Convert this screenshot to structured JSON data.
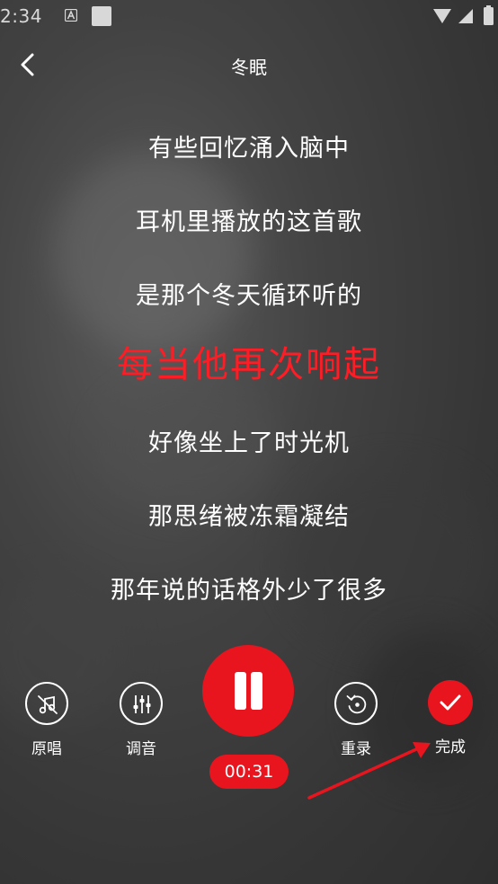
{
  "status_bar": {
    "time": "2:34"
  },
  "header": {
    "title": "冬眠"
  },
  "lyrics": {
    "lines": [
      "有些回忆涌入脑中",
      "耳机里播放的这首歌",
      "是那个冬天循环听的",
      "每当他再次响起",
      "好像坐上了时光机",
      "那思绪被冻霜凝结",
      "那年说的话格外少了很多"
    ],
    "active_index": 3
  },
  "controls": {
    "original_label": "原唱",
    "tuning_label": "调音",
    "rerecord_label": "重录",
    "done_label": "完成",
    "elapsed_time": "00:31"
  },
  "colors": {
    "accent": "#e8151f",
    "active_lyric": "#ff1c24"
  }
}
